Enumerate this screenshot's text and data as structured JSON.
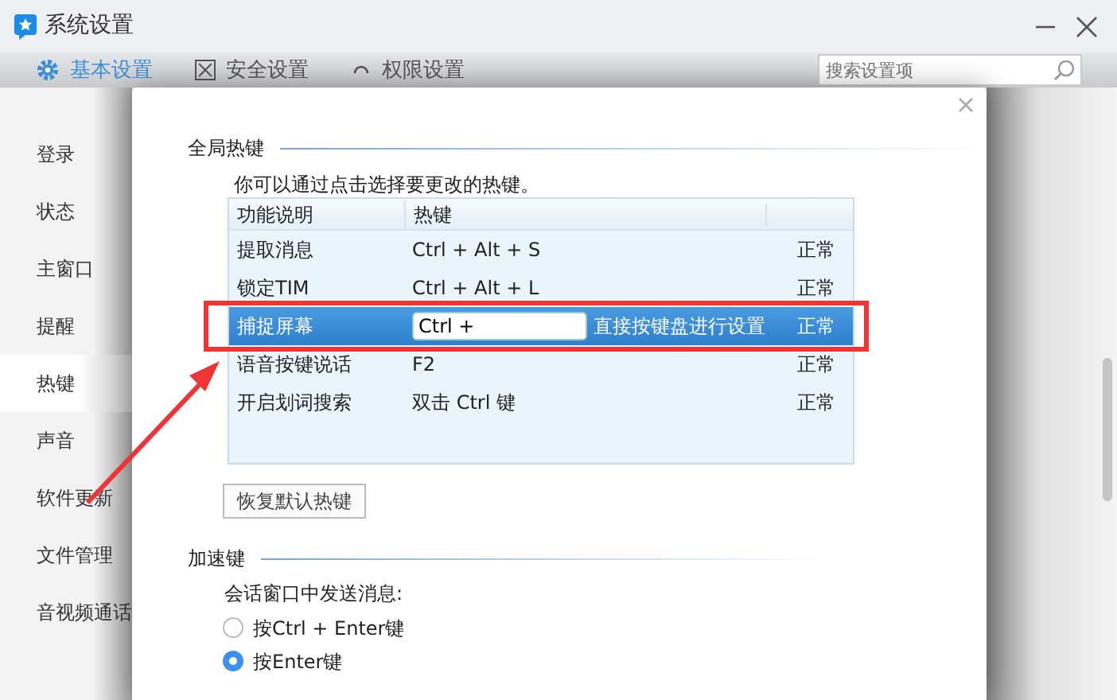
{
  "window": {
    "title": "系统设置"
  },
  "tabs": [
    {
      "label": "基本设置",
      "selected": true
    },
    {
      "label": "安全设置",
      "selected": false
    },
    {
      "label": "权限设置",
      "selected": false
    }
  ],
  "search": {
    "placeholder": "搜索设置项"
  },
  "sidebar": {
    "items": [
      {
        "label": "登录",
        "selected": false
      },
      {
        "label": "状态",
        "selected": false
      },
      {
        "label": "主窗口",
        "selected": false
      },
      {
        "label": "提醒",
        "selected": false
      },
      {
        "label": "热键",
        "selected": true
      },
      {
        "label": "声音",
        "selected": false
      },
      {
        "label": "软件更新",
        "selected": false
      },
      {
        "label": "文件管理",
        "selected": false
      },
      {
        "label": "音视频通话",
        "selected": false
      }
    ]
  },
  "global_hotkeys": {
    "title": "全局热键",
    "hint": "你可以通过点击选择要更改的热键。",
    "table": {
      "columns": [
        "功能说明",
        "热键"
      ],
      "rows": [
        {
          "name": "提取消息",
          "hotkey": "Ctrl + Alt + S",
          "status": "正常",
          "selected": false
        },
        {
          "name": "锁定TIM",
          "hotkey": "Ctrl + Alt + L",
          "status": "正常",
          "selected": false
        },
        {
          "name": "捕捉屏幕",
          "hotkey": "Ctrl +",
          "note": "直接按键盘进行设置",
          "status": "正常",
          "selected": true
        },
        {
          "name": "语音按键说话",
          "hotkey": "F2",
          "status": "正常",
          "selected": false
        },
        {
          "name": "开启划词搜索",
          "hotkey": "双击 Ctrl 键",
          "status": "正常",
          "selected": false
        }
      ]
    },
    "reset_button": "恢复默认热键"
  },
  "accelerator": {
    "title": "加速键",
    "label": "会话窗口中发送消息:",
    "options": [
      {
        "label": "按Ctrl + Enter键",
        "selected": false
      },
      {
        "label": "按Enter键",
        "selected": true
      }
    ]
  }
}
